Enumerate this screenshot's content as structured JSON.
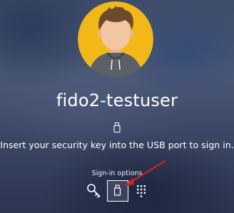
{
  "user": {
    "name": "fido2-testuser",
    "avatar_icon": "user-avatar"
  },
  "prompt": {
    "icon": "usb-key-icon",
    "message": "Insert your security key into the USB port to sign in."
  },
  "signin_options": {
    "label": "Sign-in options",
    "options": [
      {
        "icon": "key-icon",
        "selected": false
      },
      {
        "icon": "usb-security-key-icon",
        "selected": true
      },
      {
        "icon": "pin-keypad-icon",
        "selected": false
      }
    ]
  },
  "annotation": {
    "arrow_color": "#e0201c"
  },
  "colors": {
    "avatar_background": "#f2b817",
    "text": "#ffffff"
  }
}
